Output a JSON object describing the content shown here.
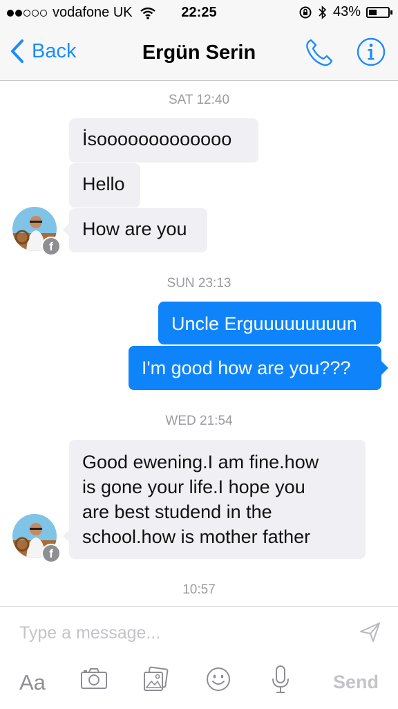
{
  "status_bar": {
    "carrier": "vodafone UK",
    "time": "22:25",
    "battery": "43%",
    "battery_level": 0.43,
    "signal_bars_filled": 2,
    "signal_bars_total": 5
  },
  "nav": {
    "back_label": "Back",
    "title": "Ergün Serin"
  },
  "conversation": {
    "stamps": [
      "SAT 12:40",
      "SUN 23:13",
      "WED 21:54",
      "10:57"
    ],
    "messages": [
      {
        "text": "İsooooooooooooo"
      },
      {
        "text": "Hello"
      },
      {
        "text": "How are you"
      },
      {
        "text": "Uncle Erguuuuuuuuun"
      },
      {
        "text": "I'm good how are you???"
      },
      {
        "lines": [
          "Good ewening.I am fine.how",
          "is gone your life.I hope you",
          "are best studend in the",
          "school.how is mother father"
        ]
      }
    ]
  },
  "composer": {
    "placeholder": "Type a message...",
    "aa_label": "Aa",
    "send_label": "Send"
  },
  "colors": {
    "accent": "#1a8cff",
    "outgoing_bubble": "#0f84fa",
    "incoming_bubble": "#f0eff4",
    "stamp_text": "#9b9ba0"
  },
  "icons": [
    "chevron-left-icon",
    "phone-icon",
    "info-icon",
    "facebook-icon",
    "send-arrow-icon",
    "camera-icon",
    "gallery-icon",
    "emoji-icon",
    "microphone-icon"
  ]
}
